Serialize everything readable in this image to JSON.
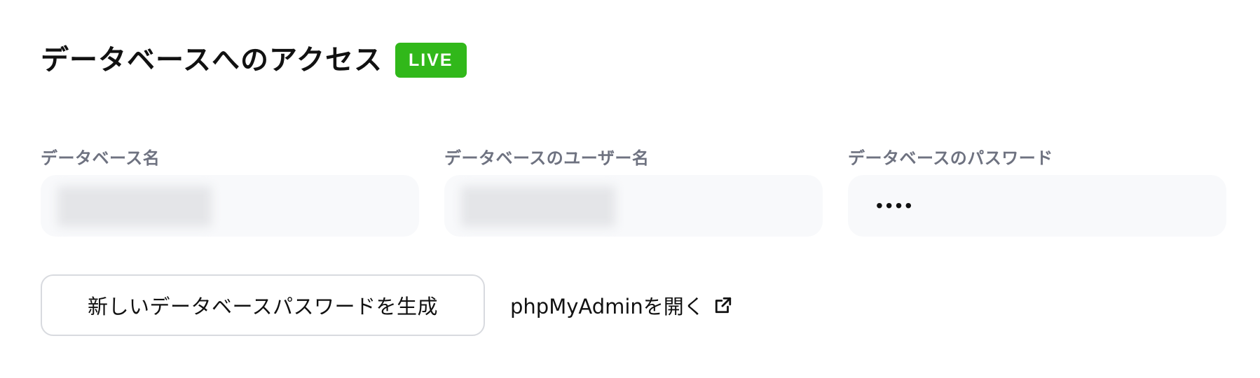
{
  "header": {
    "title": "データベースへのアクセス",
    "badge": "LIVE"
  },
  "fields": [
    {
      "label": "データベース名",
      "value_hidden": true
    },
    {
      "label": "データベースのユーザー名",
      "value_hidden": true
    },
    {
      "label": "データベースのパスワード",
      "masked_value": "••••"
    }
  ],
  "actions": {
    "generate_button": "新しいデータベースパスワードを生成",
    "phpmyadmin_link": "phpMyAdminを開く",
    "phpmyadmin_icon": "external-link-icon"
  },
  "colors": {
    "live_badge": "#31b81a",
    "label": "#6e7280",
    "field_bg": "#f8f9fb",
    "button_border": "#d8dadf"
  }
}
